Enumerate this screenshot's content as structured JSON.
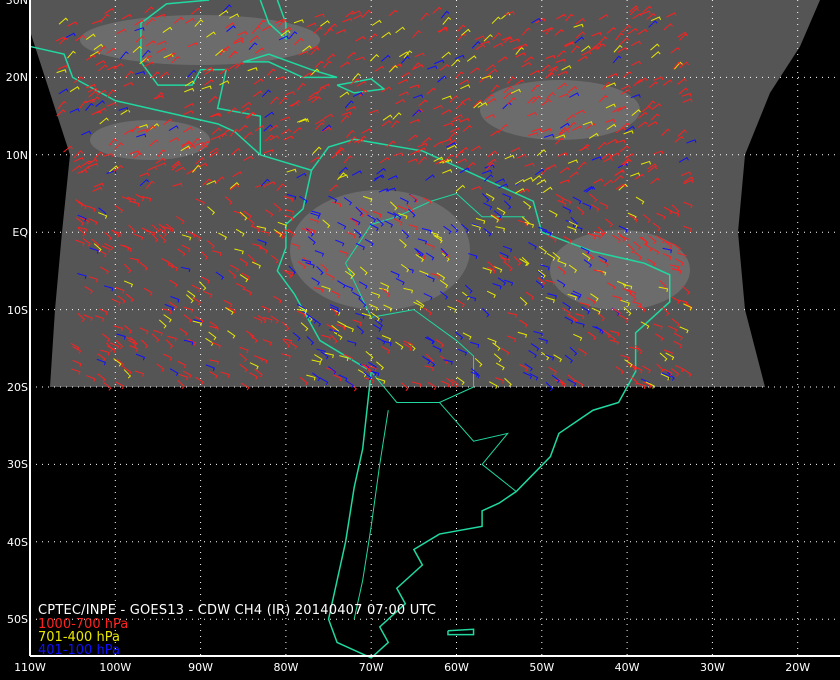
{
  "title": "CPTEC/INPE - GOES13 - CDW CH4 (IR) 20140407 07:00 UTC",
  "legend": [
    {
      "label": "1000-700 hPa",
      "color": "#ff2020"
    },
    {
      "label": "701-400 hPa",
      "color": "#e8e800"
    },
    {
      "label": "401-100 hPa",
      "color": "#1010ff"
    }
  ],
  "lat_labels": [
    "30N",
    "20N",
    "10N",
    "EQ",
    "10S",
    "20S",
    "30S",
    "40S",
    "50S"
  ],
  "lon_labels": [
    "110W",
    "100W",
    "90W",
    "80W",
    "70W",
    "60W",
    "50W",
    "40W",
    "30W",
    "20W"
  ],
  "colors": {
    "coastline": "#20d8a0",
    "grid": "#ffffff",
    "satellite": "#555555"
  }
}
